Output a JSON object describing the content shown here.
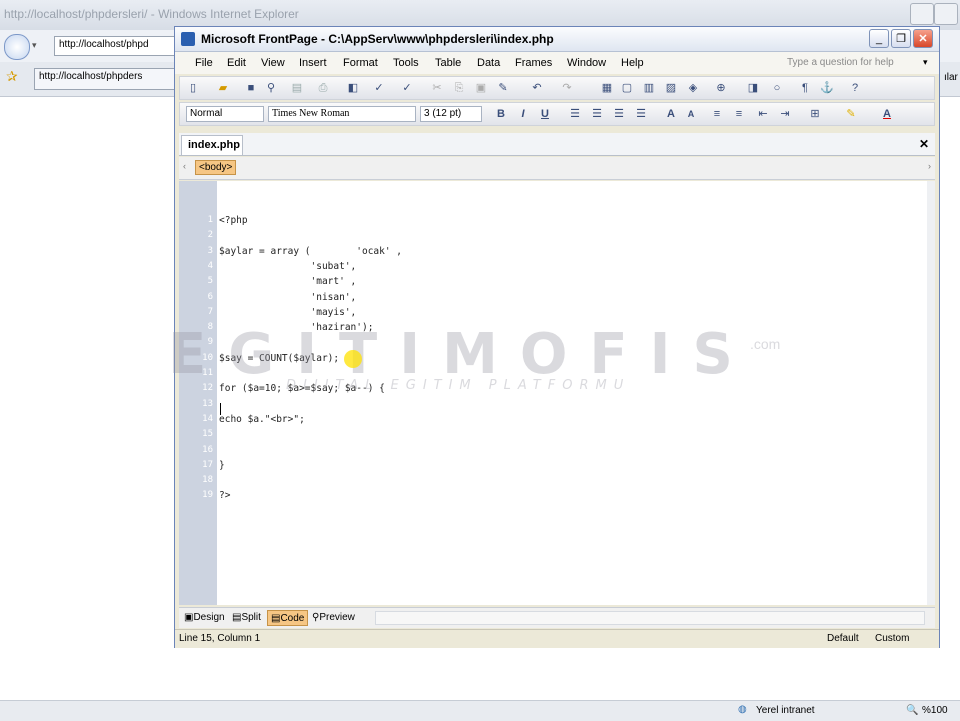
{
  "ie": {
    "title": "http://localhost/phpdersleri/ - Windows Internet Explorer",
    "address": "http://localhost/phpd",
    "tab_label": "http://localhost/phpders",
    "status_zone": "Yerel intranet",
    "status_zoom": "%100",
    "side_text": "ılar"
  },
  "frontpage": {
    "title": "Microsoft FrontPage - C:\\AppServ\\www\\phpdersleri\\index.php",
    "menu": [
      "File",
      "Edit",
      "View",
      "Insert",
      "Format",
      "Tools",
      "Table",
      "Data",
      "Frames",
      "Window",
      "Help"
    ],
    "help_placeholder": "Type a question for help",
    "style_value": "Normal",
    "font_value": "Times New Roman",
    "size_value": "3 (12 pt)",
    "doc_tab": "index.php",
    "tag_selector": "<body>",
    "view_tabs": [
      "Design",
      "Split",
      "Code",
      "Preview"
    ],
    "active_view": "Code",
    "status_position": "Line 15, Column 1",
    "status_default": "Default",
    "status_custom": "Custom"
  },
  "code_lines": [
    {
      "n": "1",
      "text": "<?php"
    },
    {
      "n": "2",
      "text": ""
    },
    {
      "n": "3",
      "text": "$aylar = array (        'ocak' ,"
    },
    {
      "n": "4",
      "text": "                'subat',"
    },
    {
      "n": "5",
      "text": "                'mart' ,"
    },
    {
      "n": "6",
      "text": "                'nisan',"
    },
    {
      "n": "7",
      "text": "                'mayis',"
    },
    {
      "n": "8",
      "text": "                'haziran');"
    },
    {
      "n": "9",
      "text": ""
    },
    {
      "n": "10",
      "text": "$say = COUNT($aylar);"
    },
    {
      "n": "11",
      "text": ""
    },
    {
      "n": "12",
      "text": "for ($a=10; $a>=$say; $a--) {"
    },
    {
      "n": "13",
      "text": ""
    },
    {
      "n": "14",
      "text": "echo $a.\"<br>\";"
    },
    {
      "n": "15",
      "text": ""
    },
    {
      "n": "16",
      "text": ""
    },
    {
      "n": "17",
      "text": "}"
    },
    {
      "n": "18",
      "text": ""
    },
    {
      "n": "19",
      "text": "?>"
    }
  ],
  "watermark": {
    "main": "EGITIMOFIS",
    "sub": "DIJITAL EGITIM PLATFORMU",
    "com": ".com"
  }
}
